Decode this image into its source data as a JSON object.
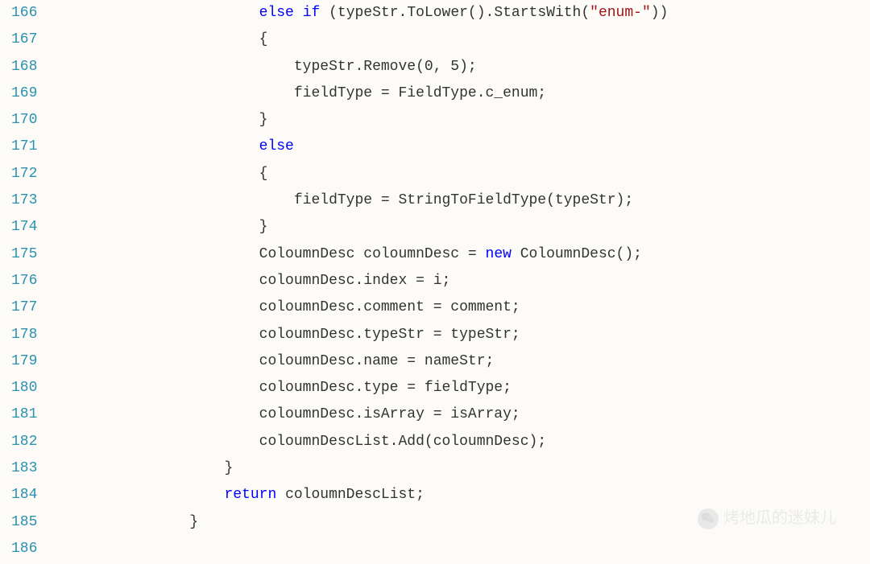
{
  "startLine": 166,
  "endLine": 186,
  "watermark": "烤地瓜的迷妹儿",
  "lines": [
    {
      "n": 166,
      "indent": "                        ",
      "tokens": [
        {
          "t": "else",
          "c": "kw"
        },
        {
          "t": " ",
          "c": "txt"
        },
        {
          "t": "if",
          "c": "kw"
        },
        {
          "t": " (typeStr.ToLower().StartsWith(",
          "c": "txt"
        },
        {
          "t": "\"enum-\"",
          "c": "str"
        },
        {
          "t": "))",
          "c": "txt"
        }
      ]
    },
    {
      "n": 167,
      "indent": "                        ",
      "tokens": [
        {
          "t": "{",
          "c": "txt"
        }
      ]
    },
    {
      "n": 168,
      "indent": "                            ",
      "tokens": [
        {
          "t": "typeStr.Remove(0, 5);",
          "c": "txt"
        }
      ]
    },
    {
      "n": 169,
      "indent": "                            ",
      "tokens": [
        {
          "t": "fieldType = FieldType.c_enum;",
          "c": "txt"
        }
      ]
    },
    {
      "n": 170,
      "indent": "                        ",
      "tokens": [
        {
          "t": "}",
          "c": "txt"
        }
      ]
    },
    {
      "n": 171,
      "indent": "                        ",
      "tokens": [
        {
          "t": "else",
          "c": "kw"
        }
      ]
    },
    {
      "n": 172,
      "indent": "                        ",
      "tokens": [
        {
          "t": "{",
          "c": "txt"
        }
      ]
    },
    {
      "n": 173,
      "indent": "                            ",
      "tokens": [
        {
          "t": "fieldType = StringToFieldType(typeStr);",
          "c": "txt"
        }
      ]
    },
    {
      "n": 174,
      "indent": "                        ",
      "tokens": [
        {
          "t": "}",
          "c": "txt"
        }
      ]
    },
    {
      "n": 175,
      "indent": "                        ",
      "tokens": [
        {
          "t": "ColoumnDesc coloumnDesc = ",
          "c": "txt"
        },
        {
          "t": "new",
          "c": "kw"
        },
        {
          "t": " ColoumnDesc();",
          "c": "txt"
        }
      ]
    },
    {
      "n": 176,
      "indent": "                        ",
      "tokens": [
        {
          "t": "coloumnDesc.index = i;",
          "c": "txt"
        }
      ]
    },
    {
      "n": 177,
      "indent": "                        ",
      "tokens": [
        {
          "t": "coloumnDesc.comment = comment;",
          "c": "txt"
        }
      ]
    },
    {
      "n": 178,
      "indent": "                        ",
      "tokens": [
        {
          "t": "coloumnDesc.typeStr = typeStr;",
          "c": "txt"
        }
      ]
    },
    {
      "n": 179,
      "indent": "                        ",
      "tokens": [
        {
          "t": "coloumnDesc.name = nameStr;",
          "c": "txt"
        }
      ]
    },
    {
      "n": 180,
      "indent": "                        ",
      "tokens": [
        {
          "t": "coloumnDesc.type = fieldType;",
          "c": "txt"
        }
      ]
    },
    {
      "n": 181,
      "indent": "                        ",
      "tokens": [
        {
          "t": "coloumnDesc.isArray = isArray;",
          "c": "txt"
        }
      ]
    },
    {
      "n": 182,
      "indent": "                        ",
      "tokens": [
        {
          "t": "coloumnDescList.Add(coloumnDesc);",
          "c": "txt"
        }
      ]
    },
    {
      "n": 183,
      "indent": "                    ",
      "tokens": [
        {
          "t": "}",
          "c": "txt"
        }
      ]
    },
    {
      "n": 184,
      "indent": "                    ",
      "tokens": [
        {
          "t": "return",
          "c": "kw"
        },
        {
          "t": " coloumnDescList;",
          "c": "txt"
        }
      ]
    },
    {
      "n": 185,
      "indent": "                ",
      "tokens": [
        {
          "t": "}",
          "c": "txt"
        }
      ]
    },
    {
      "n": 186,
      "indent": "",
      "tokens": []
    }
  ]
}
